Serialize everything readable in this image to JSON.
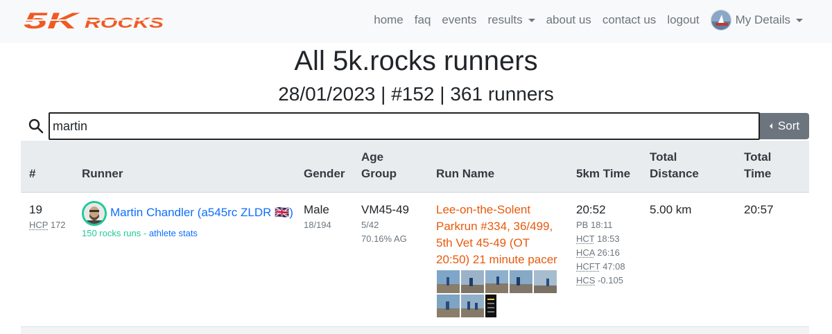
{
  "nav": {
    "brand": "5K ROCKS",
    "links": [
      {
        "label": "home"
      },
      {
        "label": "faq"
      },
      {
        "label": "events"
      },
      {
        "label": "results"
      },
      {
        "label": "about us"
      },
      {
        "label": "contact us"
      },
      {
        "label": "logout"
      }
    ],
    "my_details": "My Details"
  },
  "header": {
    "title": "All 5k.rocks runners",
    "subtitle": "28/01/2023 | #152 | 361 runners"
  },
  "search": {
    "value": "martin",
    "sort_label": "Sort"
  },
  "table": {
    "columns": {
      "num": "#",
      "runner": "Runner",
      "gender": "Gender",
      "age_1": "Age",
      "age_2": "Group",
      "run_name": "Run Name",
      "time": "5km Time",
      "dist_1": "Total",
      "dist_2": "Distance",
      "ttime_1": "Total",
      "ttime_2": "Time"
    },
    "rows": [
      {
        "position": "19",
        "hcp_label": "HCP",
        "hcp_value": "172",
        "runner_name": "Martin Chandler (a545rc ZLDR 🇬🇧)",
        "rocks_runs": "150 rocks runs - ",
        "athlete_stats": "athlete stats",
        "gender": "Male",
        "gender_pos": "18/194",
        "age_group": "VM45-49",
        "age_pos": "5/42",
        "age_grade": "70.16% AG",
        "run_name": "Lee-on-the-Solent Parkrun #334, 36/499, 5th Vet 45-49 (OT 20:50) 21 minute pacer",
        "time": "20:52",
        "pb": "PB 18:11",
        "hct_label": "HCT",
        "hct_value": "18:53",
        "hca_label": "HCA",
        "hca_value": "26:16",
        "hcft_label": "HCFT",
        "hcft_value": "47:08",
        "hcs_label": "HCS",
        "hcs_value": "-0.105",
        "distance": "5.00 km",
        "total_time": "20:57"
      }
    ]
  },
  "colors": {
    "brand_orange": "#f05a22",
    "link_blue": "#0d6efd",
    "run_orange": "#e8590c",
    "teal": "#20c997",
    "button_gray": "#6c757d"
  }
}
